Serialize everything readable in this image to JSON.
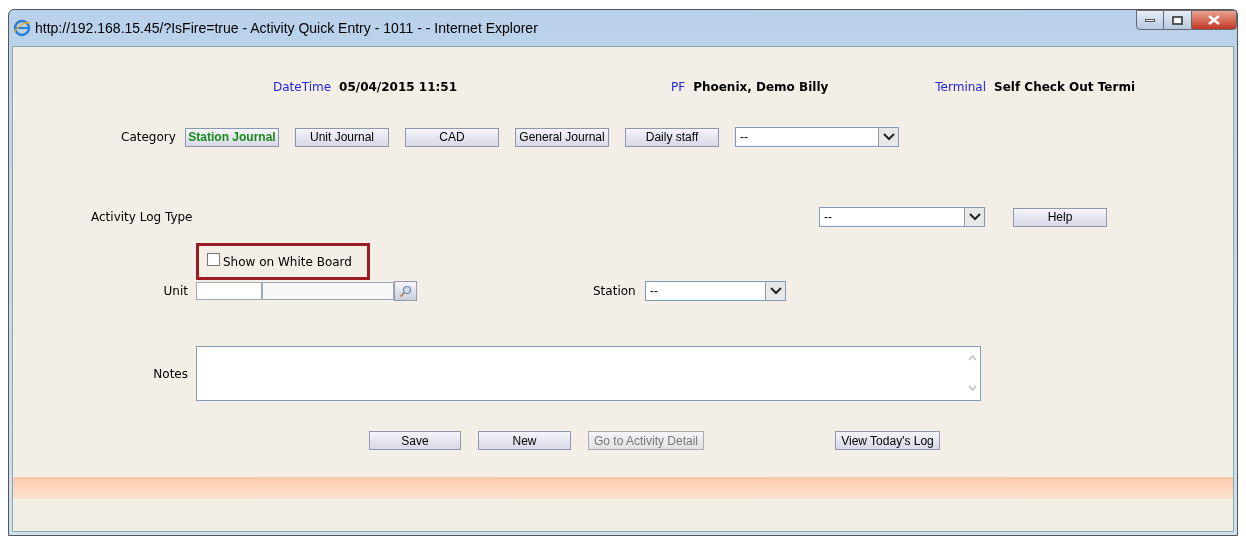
{
  "window": {
    "title": "http://192.168.15.45/?IsFire=true - Activity Quick Entry - 1011 - - Internet Explorer"
  },
  "header": [
    {
      "label": "DateTime",
      "value": "05/04/2015 11:51"
    },
    {
      "label": "PF",
      "value": "Phoenix, Demo Billy"
    },
    {
      "label": "Terminal",
      "value": "Self Check Out Termi"
    }
  ],
  "category": {
    "label": "Category",
    "options": [
      {
        "label": "Station Journal",
        "selected": true
      },
      {
        "label": "Unit Journal",
        "selected": false
      },
      {
        "label": "CAD",
        "selected": false
      },
      {
        "label": "General Journal",
        "selected": false
      },
      {
        "label": "Daily staff",
        "selected": false
      }
    ],
    "dropdown": "--"
  },
  "activity_log_type": {
    "label": "Activity Log Type",
    "dropdown": "--",
    "help_button": "Help"
  },
  "white_board": {
    "label": "Show on White Board",
    "checked": false
  },
  "unit": {
    "label": "Unit"
  },
  "station": {
    "label": "Station",
    "dropdown": "--"
  },
  "notes": {
    "label": "Notes"
  },
  "buttons": [
    {
      "label": "Save",
      "disabled": false
    },
    {
      "label": "New",
      "disabled": false
    },
    {
      "label": "Go to Activity Detail",
      "disabled": true
    },
    {
      "label": "View Today's Log",
      "disabled": false
    }
  ]
}
